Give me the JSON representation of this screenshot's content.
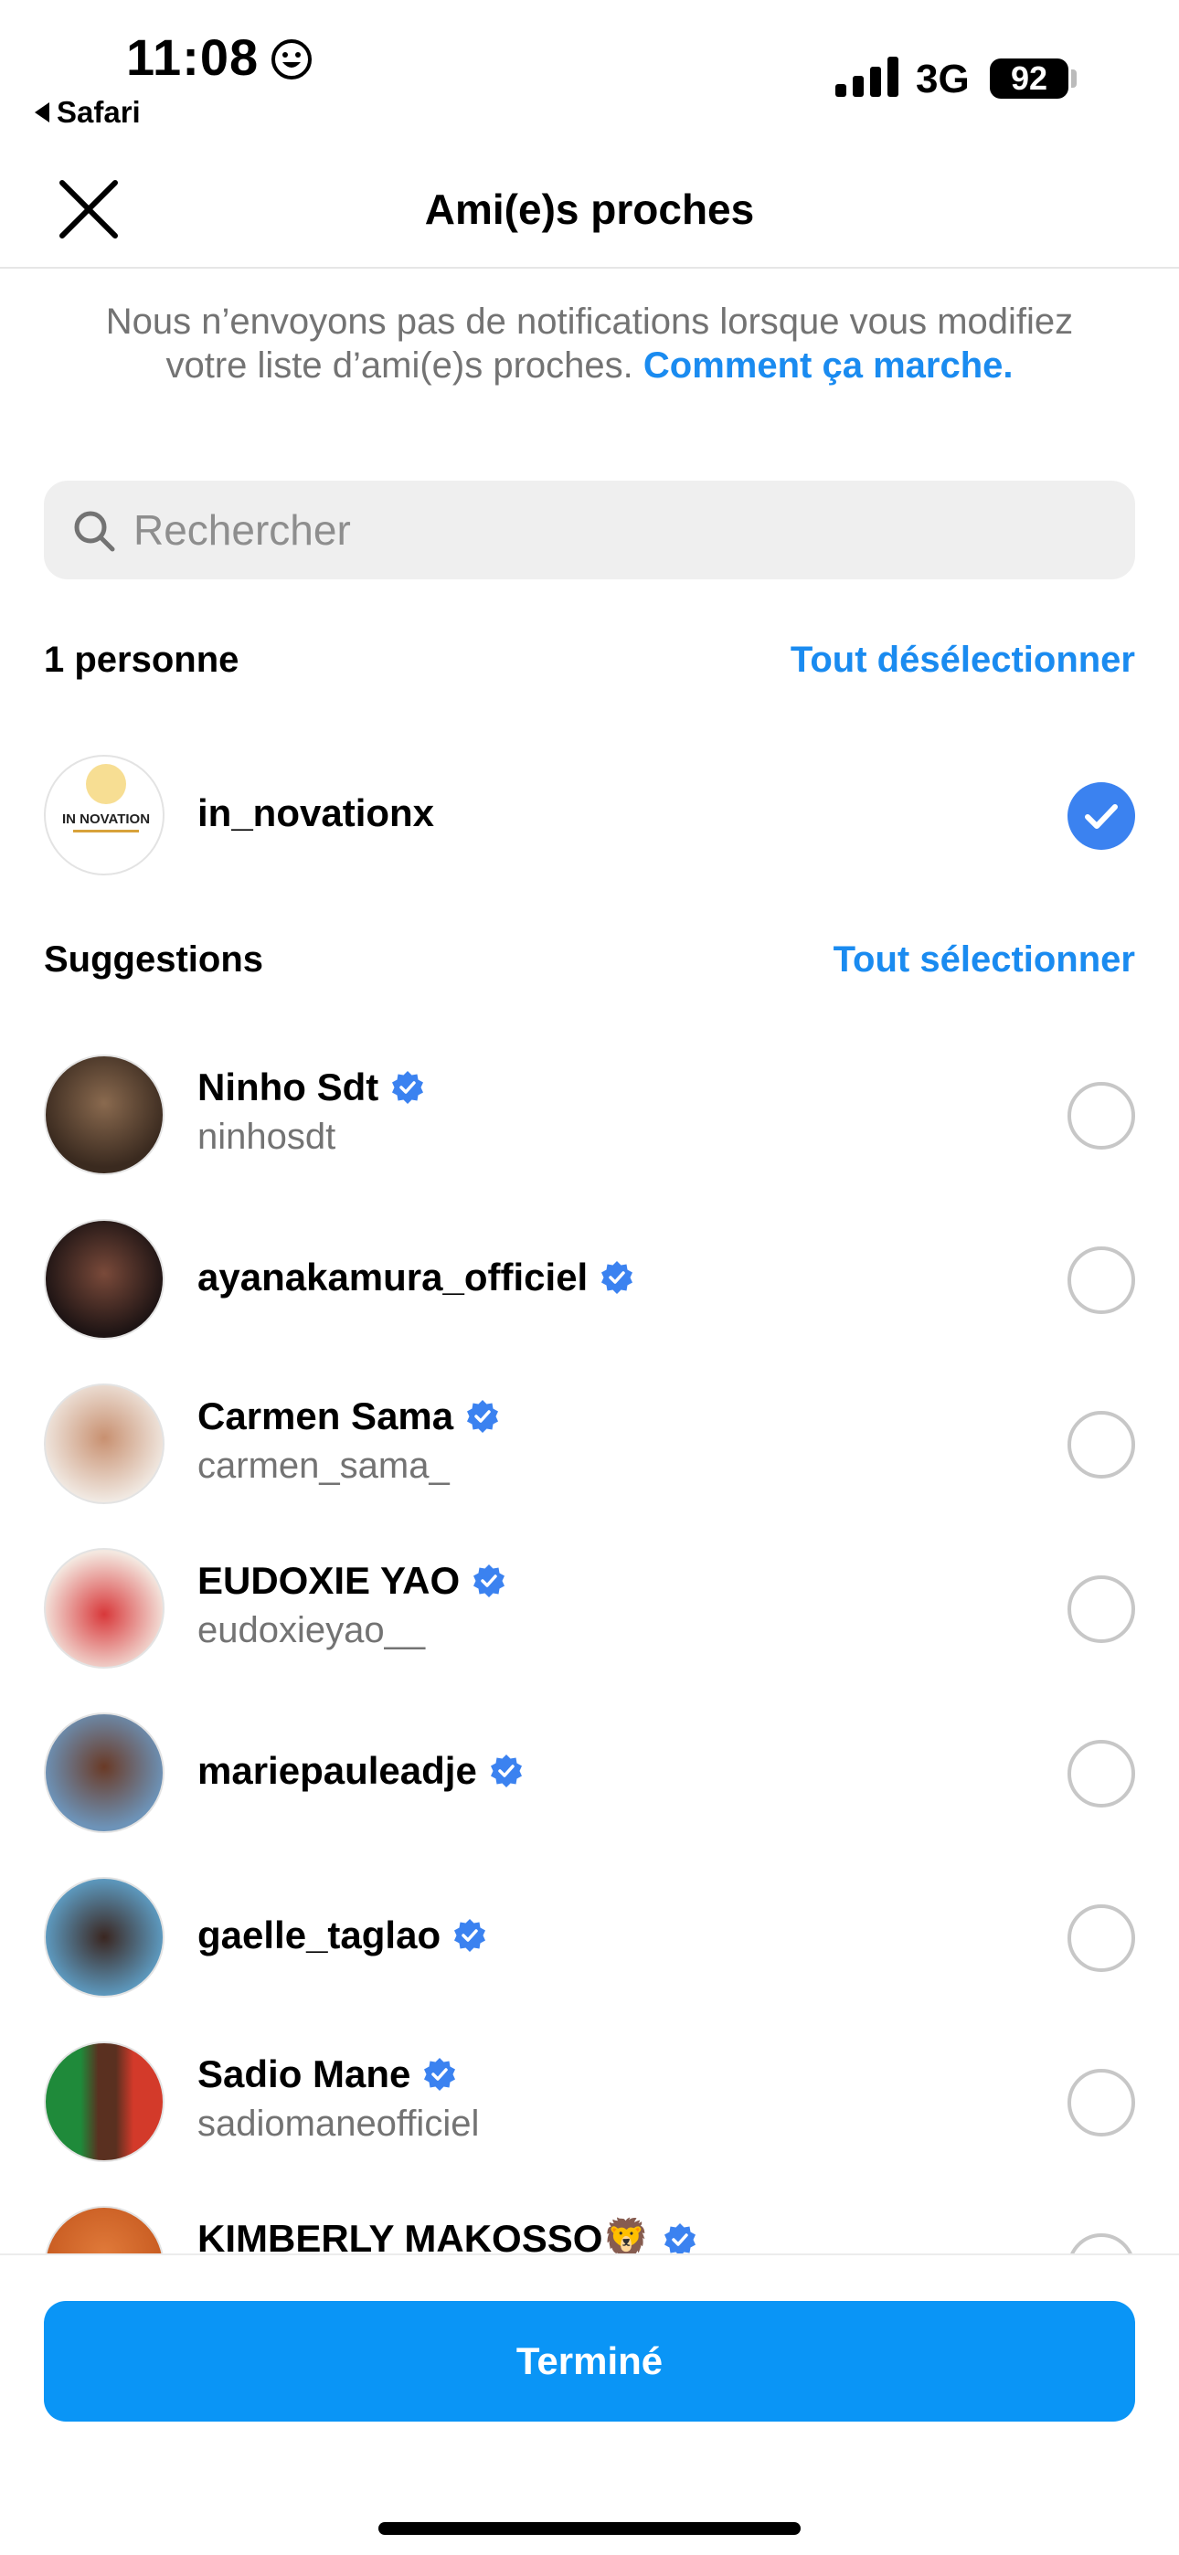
{
  "status_bar": {
    "time": "11:08",
    "back_app": "Safari",
    "network": "3G",
    "battery": "92"
  },
  "header": {
    "title": "Ami(e)s proches"
  },
  "notice": {
    "text": "Nous n’envoyons pas de notifications lorsque vous modifiez votre liste d’ami(e)s proches.",
    "link": "Comment ça marche."
  },
  "search": {
    "placeholder": "Rechercher"
  },
  "selected_section": {
    "label": "1 personne",
    "action": "Tout désélectionner",
    "people": [
      {
        "username": "in_novationx",
        "checked": true
      }
    ]
  },
  "suggestions_section": {
    "label": "Suggestions",
    "action": "Tout sélectionner",
    "people": [
      {
        "name": "Ninho Sdt",
        "handle": "ninhosdt",
        "verified": true,
        "checked": false
      },
      {
        "name": "ayanakamura_officiel",
        "handle": "",
        "verified": true,
        "checked": false
      },
      {
        "name": "Carmen Sama",
        "handle": "carmen_sama_",
        "verified": true,
        "checked": false
      },
      {
        "name": "EUDOXIE YAO",
        "handle": "eudoxieyao__",
        "verified": true,
        "checked": false
      },
      {
        "name": "mariepauleadje",
        "handle": "",
        "verified": true,
        "checked": false
      },
      {
        "name": "gaelle_taglao",
        "handle": "",
        "verified": true,
        "checked": false
      },
      {
        "name": "Sadio Mane",
        "handle": "sadiomaneofficiel",
        "verified": true,
        "checked": false
      },
      {
        "name": "KIMBERLY MAKOSSO🦁",
        "handle": "",
        "verified": true,
        "checked": false
      }
    ]
  },
  "footer": {
    "done_label": "Terminé"
  },
  "colors": {
    "accent": "#1a8bf0",
    "button": "#0a95f6",
    "check": "#3b82f0",
    "muted": "#737373"
  }
}
